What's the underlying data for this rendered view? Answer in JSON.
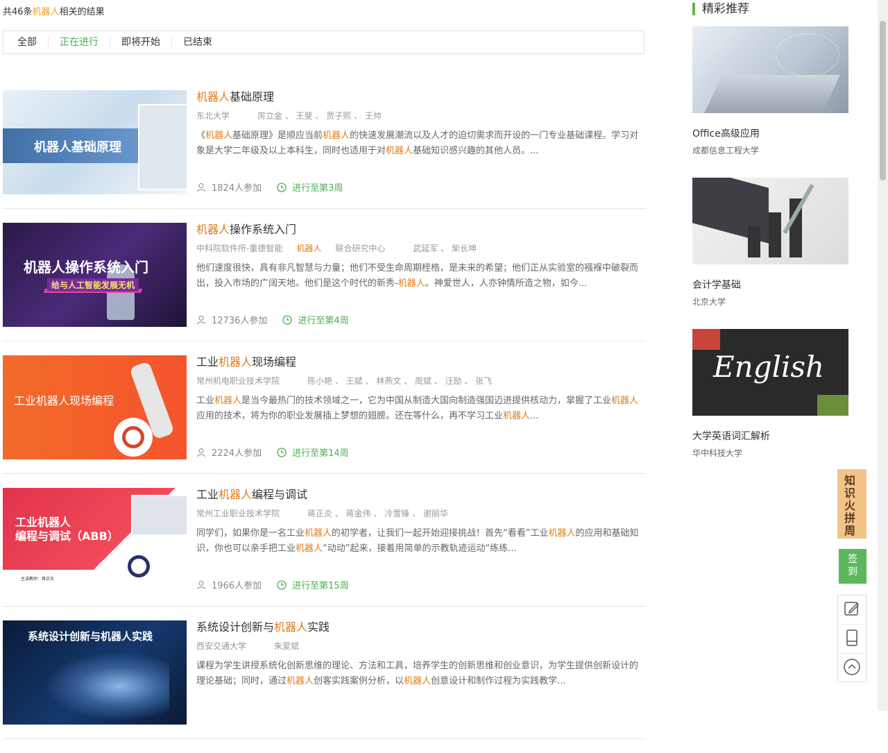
{
  "search_summary": {
    "prefix": "共46条",
    "keyword": "机器人",
    "suffix": "相关的结果"
  },
  "filters": [
    "全部",
    "正在进行",
    "即将开始",
    "已结束"
  ],
  "active_filter": "正在进行",
  "keyword": "机器人",
  "courses": [
    {
      "thumb_text": "机器人基础原理",
      "title": [
        {
          "t": "机器人",
          "hl": true
        },
        {
          "t": "基础原理",
          "hl": false
        }
      ],
      "school": [
        {
          "t": "东北大学",
          "hl": false
        }
      ],
      "teachers": "房立金 、 王斐 、 贾子熙 、 王帅",
      "desc": [
        {
          "t": "《",
          "hl": false
        },
        {
          "t": "机器人",
          "hl": true
        },
        {
          "t": "基础原理》是顺应当前",
          "hl": false
        },
        {
          "t": "机器人",
          "hl": true
        },
        {
          "t": "的快速发展潮流以及人才的迫切需求而开设的一门专业基础课程。学习对象是大学二年级及以上本科生，同时也适用于对",
          "hl": false
        },
        {
          "t": "机器人",
          "hl": true
        },
        {
          "t": "基础知识感兴趣的其他人员。...",
          "hl": false
        }
      ],
      "participants": "1824人参加",
      "progress": "进行至第3周"
    },
    {
      "thumb_text": "机器人操作系统入门",
      "thumb_sub": "给与人工智能发展无机",
      "title": [
        {
          "t": "机器人",
          "hl": true
        },
        {
          "t": "操作系统入门",
          "hl": false
        }
      ],
      "school": [
        {
          "t": "中科院软件所-重德智能",
          "hl": false
        },
        {
          "t": "机器人",
          "hl": true
        },
        {
          "t": "联合研究中心",
          "hl": false
        }
      ],
      "teachers": "武延军 、 柴长坤",
      "desc": [
        {
          "t": "他们速度很快，具有非凡智慧与力量；他们不受生命周期桎梏，是未来的希望；他们正从实验室的襁褓中破裂而出，投入市场的广阔天地。他们是这个时代的新秀-",
          "hl": false
        },
        {
          "t": "机器人",
          "hl": true
        },
        {
          "t": "。神爱世人，人亦钟情所造之物，如今...",
          "hl": false
        }
      ],
      "participants": "12736人参加",
      "progress": "进行至第4周"
    },
    {
      "thumb_text": "工业机器人现场编程",
      "title": [
        {
          "t": "工业",
          "hl": false
        },
        {
          "t": "机器人",
          "hl": true
        },
        {
          "t": "现场编程",
          "hl": false
        }
      ],
      "school": [
        {
          "t": "常州机电职业技术学院",
          "hl": false
        }
      ],
      "teachers": "陈小艳 、 王斌 、 林燕文 、 周斌 、 汪励 、 张飞",
      "desc": [
        {
          "t": "工业",
          "hl": false
        },
        {
          "t": "机器人",
          "hl": true
        },
        {
          "t": "是当今最热门的技术领域之一，它为中国从制造大国向制造强国迈进提供核动力，掌握了工业",
          "hl": false
        },
        {
          "t": "机器人",
          "hl": true
        },
        {
          "t": "应用的技术，将为你的职业发展插上梦想的翅膀。还在等什么，再不学习工业",
          "hl": false
        },
        {
          "t": "机器人",
          "hl": true
        },
        {
          "t": "...",
          "hl": false
        }
      ],
      "participants": "2224人参加",
      "progress": "进行至第14周"
    },
    {
      "thumb_text": "工业机器人\n编程与调试（ABB）",
      "thumb_sub": "主讲教师：蒋正炎",
      "title": [
        {
          "t": "工业",
          "hl": false
        },
        {
          "t": "机器人",
          "hl": true
        },
        {
          "t": "编程与调试",
          "hl": false
        }
      ],
      "school": [
        {
          "t": "常州工业职业技术学院",
          "hl": false
        }
      ],
      "teachers": "蒋正炎 、 蒋金伟 、 冷雪锋 、 谢丽华",
      "desc": [
        {
          "t": "同学们，如果你是一名工业",
          "hl": false
        },
        {
          "t": "机器人",
          "hl": true
        },
        {
          "t": "的初学者，让我们一起开始迎接挑战！首先“看看”工业",
          "hl": false
        },
        {
          "t": "机器人",
          "hl": true
        },
        {
          "t": "的应用和基础知识，你也可以亲手把工业",
          "hl": false
        },
        {
          "t": "机器人",
          "hl": true
        },
        {
          "t": "“动动”起来，接着用简单的示教轨迹运动“练练...",
          "hl": false
        }
      ],
      "participants": "1966人参加",
      "progress": "进行至第15周"
    },
    {
      "thumb_text": "系统设计创新与机器人实践",
      "title": [
        {
          "t": "系统设计创新与",
          "hl": false
        },
        {
          "t": "机器人",
          "hl": true
        },
        {
          "t": "实践",
          "hl": false
        }
      ],
      "school": [
        {
          "t": "西安交通大学",
          "hl": false
        }
      ],
      "teachers": "朱爱斌",
      "desc": [
        {
          "t": "课程为学生讲授系统化创新思维的理论、方法和工具，培养学生的创新思维和创业意识，为学生提供创新设计的理论基础；同时，通过",
          "hl": false
        },
        {
          "t": "机器人",
          "hl": true
        },
        {
          "t": "创客实践案例分析，以",
          "hl": false
        },
        {
          "t": "机器人",
          "hl": true
        },
        {
          "t": "创意设计和制作过程为实践教学...",
          "hl": false
        }
      ],
      "participants": "",
      "progress": ""
    }
  ],
  "sidebar": {
    "heading": "精彩推荐",
    "items": [
      {
        "title": "Office高级应用",
        "school": "成都信息工程大学"
      },
      {
        "title": "会计学基础",
        "school": "北京大学"
      },
      {
        "title": "大学英语词汇解析",
        "school": "华中科技大学",
        "img_text": "English"
      }
    ]
  },
  "float": {
    "banner": "知识火拼周",
    "sign": "签到"
  },
  "colors": {
    "accent_green": "#4caf50",
    "keyword_orange": "#e07b1a",
    "sidebar_bar": "#6ab04c"
  }
}
